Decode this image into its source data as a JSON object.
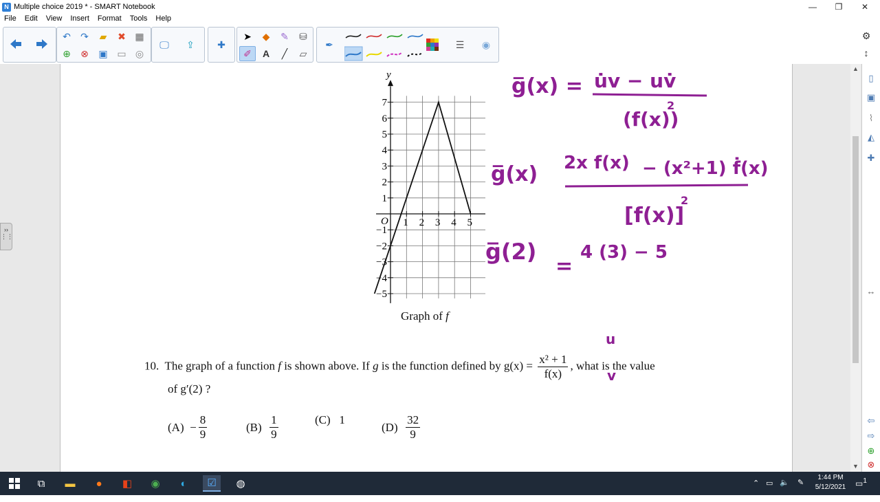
{
  "window": {
    "title": "Multiple choice 2019 * - SMART Notebook",
    "app_icon_glyph": "N",
    "controls": {
      "minimize": "—",
      "maximize": "❐",
      "close": "✕"
    }
  },
  "menu": [
    "File",
    "Edit",
    "View",
    "Insert",
    "Format",
    "Tools",
    "Help"
  ],
  "graph": {
    "axis_x_label": "x",
    "axis_y_label": "y",
    "origin_label": "O",
    "x_ticks": [
      "1",
      "2",
      "3",
      "4",
      "5"
    ],
    "y_ticks": [
      "7",
      "6",
      "5",
      "4",
      "3",
      "2",
      "1",
      "−1",
      "−2",
      "−3",
      "−4",
      "−5"
    ],
    "caption_text": "Graph of",
    "caption_fn": "f",
    "function_points": [
      [
        -1,
        -5
      ],
      [
        3,
        7
      ],
      [
        5,
        0
      ]
    ]
  },
  "question": {
    "number": "10.",
    "text_a": "The graph of a function",
    "var_f": "f",
    "text_b": "is shown above. If",
    "var_g": "g",
    "text_c": "is the function defined by",
    "g_of_x": "g(x) =",
    "frac_num": "x² + 1",
    "frac_den": "f(x)",
    "text_d": ", what is the value",
    "line2": "of g′(2) ?"
  },
  "choices": [
    {
      "letter": "(A)",
      "sign": "−",
      "num": "8",
      "den": "9"
    },
    {
      "letter": "(B)",
      "sign": "",
      "num": "1",
      "den": "9"
    },
    {
      "letter": "(C)",
      "plain": "1"
    },
    {
      "letter": "(D)",
      "sign": "",
      "num": "32",
      "den": "9"
    }
  ],
  "ink_color": "#8e1f93",
  "handwriting": {
    "line1_lhs": "g̅(x) =",
    "line1_num": "u̇v − uv̇",
    "line1_den": "(f(x))",
    "line1_exp": "2",
    "line2_lhs": "g̅(x)",
    "line2_num_a": "2x f(x)",
    "line2_num_b": "− (x²+1) ḟ(x)",
    "line2_den": "[f(x)]",
    "line2_exp": "2",
    "line3_lhs": "g̅(2)",
    "line3_eq": "=",
    "line3_rhs": "4 (3) − 5",
    "u_label": "u",
    "v_label": "v"
  },
  "taskbar": {
    "time": "1:44 PM",
    "date": "5/12/2021",
    "notification_count": "1"
  }
}
